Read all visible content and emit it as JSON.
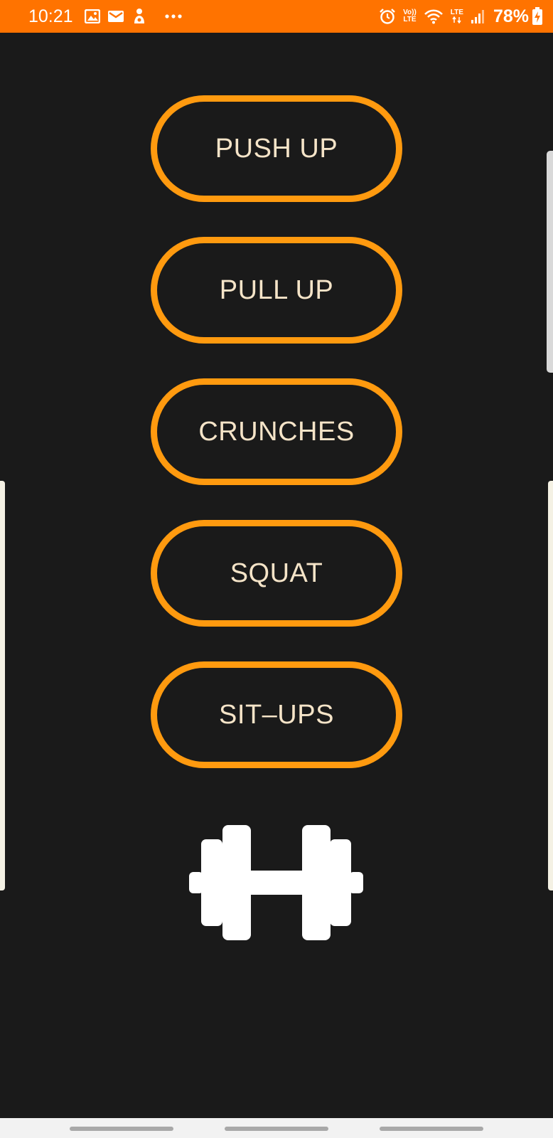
{
  "status_bar": {
    "time": "10:21",
    "icons_left": [
      "gallery-icon",
      "mail-icon",
      "notification-icon",
      "more-dots-icon"
    ],
    "icons_right": [
      "alarm-icon",
      "volte-icon",
      "wifi-icon",
      "lte-icon",
      "signal-icon",
      "battery-charging-icon"
    ],
    "volte_text_top": "Vo))",
    "volte_text_bottom": "LTE",
    "lte_text": "LTE",
    "battery": "78%",
    "background_color": "#ff7300"
  },
  "exercises": [
    {
      "label": "PUSH UP"
    },
    {
      "label": "PULL UP"
    },
    {
      "label": "CRUNCHES"
    },
    {
      "label": "SQUAT"
    },
    {
      "label": "SIT–UPS"
    }
  ],
  "logo": {
    "icon": "dumbbell-icon"
  },
  "theme": {
    "background": "#1a1a1a",
    "button_border": "#ff9a0f",
    "button_text": "#f5e4c8"
  }
}
